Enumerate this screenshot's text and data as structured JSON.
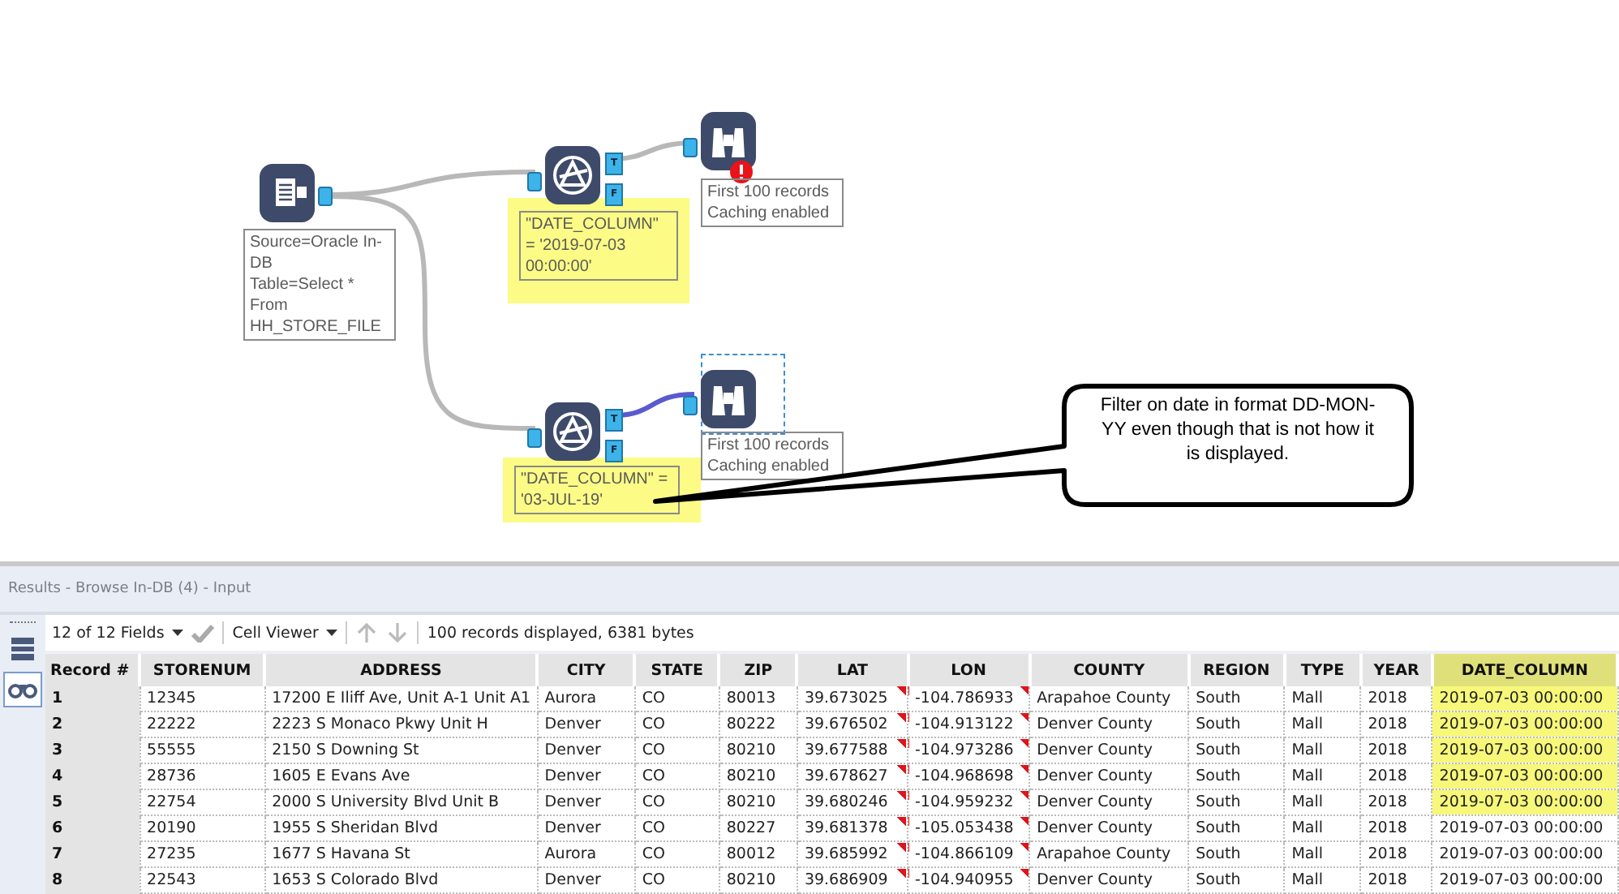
{
  "canvas": {
    "tools": [
      {
        "kind": "input",
        "annotation": [
          "Source=Oracle In-DB",
          "Table=Select * From HH_STORE_FILE"
        ],
        "highlighted": false,
        "error": false,
        "selected": false
      },
      {
        "kind": "filter",
        "annotation": [
          "\"DATE_COLUMN\" = '2019-07-03 00:00:00'"
        ],
        "highlighted": true,
        "error": false,
        "selected": false,
        "outputs": [
          "T",
          "F"
        ]
      },
      {
        "kind": "browse",
        "annotation": [
          "First 100 records",
          "Caching enabled"
        ],
        "highlighted": false,
        "error": true,
        "selected": false
      },
      {
        "kind": "filter",
        "annotation": [
          "\"DATE_COLUMN\" = '03-JUL-19'"
        ],
        "highlighted": true,
        "error": false,
        "selected": false,
        "outputs": [
          "T",
          "F"
        ]
      },
      {
        "kind": "browse",
        "annotation": [
          "First 100 records",
          "Caching enabled"
        ],
        "highlighted": false,
        "error": false,
        "selected": true
      }
    ],
    "callout": "Filter on date in format DD-MON-YY even though that is not how it is displayed."
  },
  "results": {
    "title": "Results - Browse In-DB (4) - Input",
    "toolbar": {
      "fields": "12 of 12 Fields",
      "viewer": "Cell Viewer",
      "status": "100 records displayed, 6381 bytes"
    },
    "columns": [
      {
        "label": "Record #",
        "flagged": false,
        "highlighted": false
      },
      {
        "label": "STORENUM",
        "flagged": false,
        "highlighted": false
      },
      {
        "label": "ADDRESS",
        "flagged": false,
        "highlighted": false
      },
      {
        "label": "CITY",
        "flagged": false,
        "highlighted": false
      },
      {
        "label": "STATE",
        "flagged": false,
        "highlighted": false
      },
      {
        "label": "ZIP",
        "flagged": false,
        "highlighted": false
      },
      {
        "label": "LAT",
        "flagged": true,
        "highlighted": false
      },
      {
        "label": "LON",
        "flagged": true,
        "highlighted": false
      },
      {
        "label": "COUNTY",
        "flagged": false,
        "highlighted": false
      },
      {
        "label": "REGION",
        "flagged": false,
        "highlighted": false
      },
      {
        "label": "TYPE",
        "flagged": false,
        "highlighted": false
      },
      {
        "label": "YEAR",
        "flagged": false,
        "highlighted": false
      },
      {
        "label": "DATE_COLUMN",
        "flagged": false,
        "highlighted": true
      }
    ],
    "rows": [
      {
        "highlighted": true,
        "cells": [
          "1",
          "12345",
          "17200 E Iliff Ave, Unit A-1 Unit A1",
          "Aurora",
          "CO",
          "80013",
          "39.673025",
          "-104.786933",
          "Arapahoe County",
          "South",
          "Mall",
          "2018",
          "2019-07-03 00:00:00"
        ]
      },
      {
        "highlighted": true,
        "cells": [
          "2",
          "22222",
          "2223 S Monaco Pkwy Unit H",
          "Denver",
          "CO",
          "80222",
          "39.676502",
          "-104.913122",
          "Denver County",
          "South",
          "Mall",
          "2018",
          "2019-07-03 00:00:00"
        ]
      },
      {
        "highlighted": true,
        "cells": [
          "3",
          "55555",
          "2150 S Downing St",
          "Denver",
          "CO",
          "80210",
          "39.677588",
          "-104.973286",
          "Denver County",
          "South",
          "Mall",
          "2018",
          "2019-07-03 00:00:00"
        ]
      },
      {
        "highlighted": true,
        "cells": [
          "4",
          "28736",
          "1605 E Evans Ave",
          "Denver",
          "CO",
          "80210",
          "39.678627",
          "-104.968698",
          "Denver County",
          "South",
          "Mall",
          "2018",
          "2019-07-03 00:00:00"
        ]
      },
      {
        "highlighted": true,
        "cells": [
          "5",
          "22754",
          "2000 S University Blvd Unit B",
          "Denver",
          "CO",
          "80210",
          "39.680246",
          "-104.959232",
          "Denver County",
          "South",
          "Mall",
          "2018",
          "2019-07-03 00:00:00"
        ]
      },
      {
        "highlighted": false,
        "cells": [
          "6",
          "20190",
          "1955 S Sheridan Blvd",
          "Denver",
          "CO",
          "80227",
          "39.681378",
          "-105.053438",
          "Denver County",
          "South",
          "Mall",
          "2018",
          "2019-07-03 00:00:00"
        ]
      },
      {
        "highlighted": false,
        "cells": [
          "7",
          "27235",
          "1677 S Havana St",
          "Aurora",
          "CO",
          "80012",
          "39.685992",
          "-104.866109",
          "Arapahoe County",
          "South",
          "Mall",
          "2018",
          "2019-07-03 00:00:00"
        ]
      },
      {
        "highlighted": false,
        "cells": [
          "8",
          "22543",
          "1653 S Colorado Blvd",
          "Denver",
          "CO",
          "80210",
          "39.686909",
          "-104.940955",
          "Denver County",
          "South",
          "Mall",
          "2018",
          "2019-07-03 00:00:00"
        ]
      }
    ]
  }
}
